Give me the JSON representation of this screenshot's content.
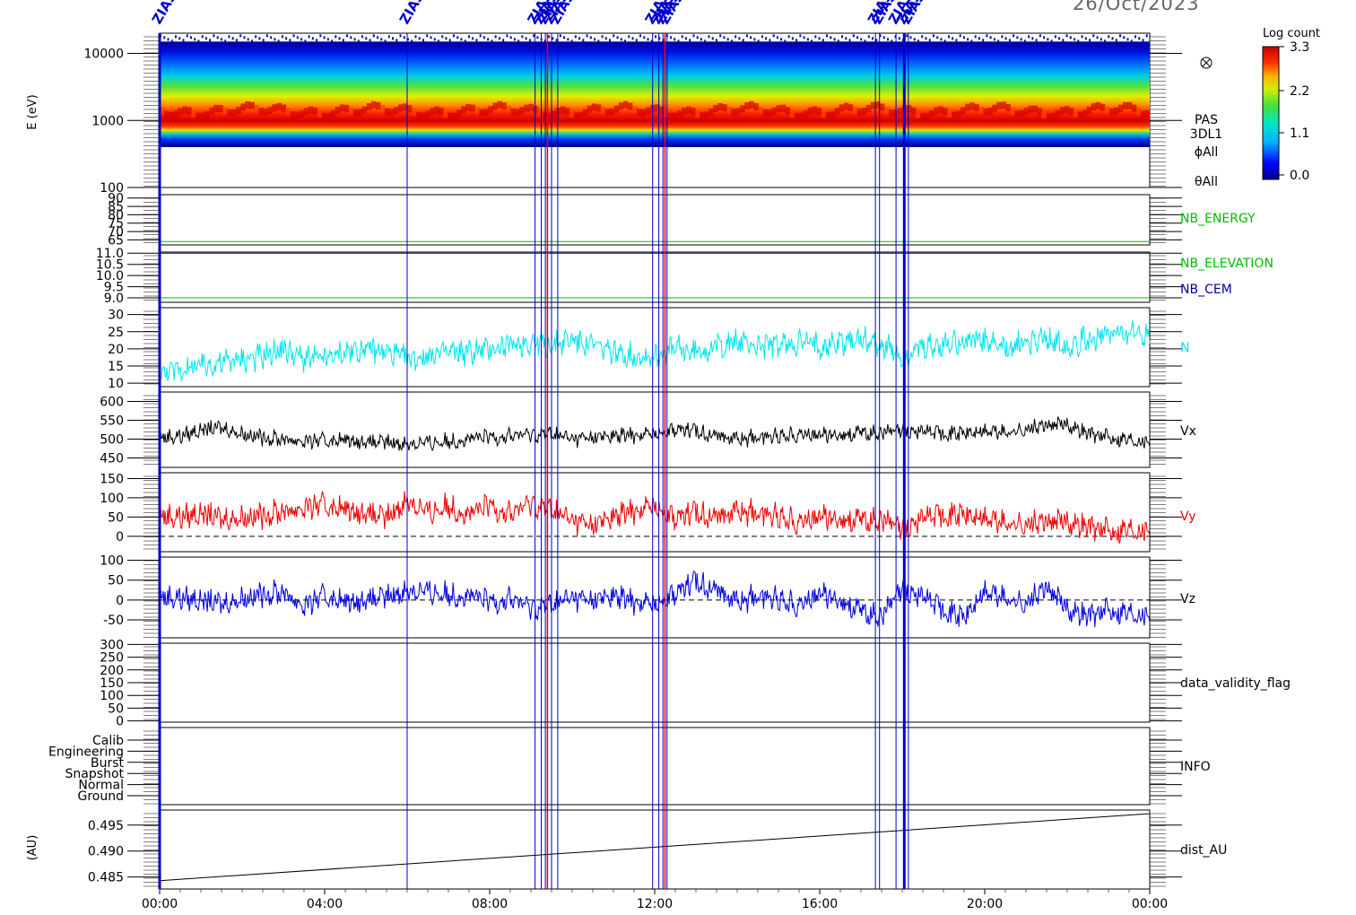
{
  "date_title": "26/Oct/2023",
  "colorbar": {
    "title": "Log count",
    "ticks": [
      "3.3",
      "2.2",
      "1.1",
      "0.0"
    ]
  },
  "x_ticks": [
    "00:00",
    "04:00",
    "08:00",
    "12:00",
    "16:00",
    "20:00",
    "00:00"
  ],
  "event_label": "ZIAS",
  "panel_labels": {
    "spectrogram": [
      "PAS",
      "3DL1",
      "ϕAll",
      "θAll"
    ],
    "nb_energy": "NB_ENERGY",
    "nb_elevation": "NB_ELEVATION",
    "nb_cem": "NB_CEM",
    "density": "N",
    "vx": "Vx",
    "vy": "Vy",
    "vz": "Vz",
    "validity": "data_validity_flag",
    "info": "INFO",
    "dist": "dist_AU"
  },
  "y_axis_labels": {
    "spectrogram": "E (eV)",
    "dist": "(AU)"
  },
  "colors": {
    "density": "#00e5ee",
    "vx": "#000000",
    "vy": "#ee0000",
    "vz": "#0000dd",
    "nb_energy_label": "#00bb00",
    "nb_elevation_label": "#00bb00",
    "nb_cem_label": "#0000aa",
    "event_lines": "#0000cc",
    "event_line_red": "#ee0000"
  },
  "chart_data": [
    {
      "type": "heatmap",
      "name_shown": "PAS 3DL1",
      "ylabel": "E (eV)",
      "y_scale": "log",
      "ylim": [
        100,
        20000
      ],
      "y_ticks": [
        "10000",
        "1000",
        "100"
      ],
      "x_range_hours": [
        0,
        24
      ],
      "colorbar_range": [
        0.0,
        3.3
      ],
      "peak_energy_eV": 1300,
      "data_energy_range_eV": [
        400,
        15000
      ]
    },
    {
      "type": "line",
      "label": "NB_ENERGY",
      "y_ticks": [
        "90",
        "85",
        "80",
        "75",
        "70",
        "65"
      ],
      "ylim": [
        62,
        92
      ],
      "value": 64
    },
    {
      "type": "line",
      "labels": [
        "NB_ELEVATION",
        "NB_CEM"
      ],
      "y_ticks": [
        "11.0",
        "10.5",
        "10.0",
        "9.5",
        "9.0"
      ],
      "ylim": [
        8.8,
        11.05
      ],
      "nb_cem_value": 11.0,
      "nb_elevation_value": 9.0
    },
    {
      "type": "line",
      "label": "N",
      "y_ticks": [
        "30",
        "25",
        "20",
        "15",
        "10"
      ],
      "ylim": [
        9,
        32
      ],
      "x": [
        0,
        0.5,
        1,
        1.5,
        2,
        2.5,
        3,
        3.5,
        4,
        4.5,
        5,
        5.5,
        6,
        6.5,
        7,
        7.5,
        8,
        8.5,
        9,
        9.5,
        10,
        10.5,
        11,
        11.5,
        12,
        12.5,
        13,
        13.5,
        14,
        14.5,
        15,
        15.5,
        16,
        16.5,
        17,
        17.5,
        18,
        18.5,
        19,
        19.5,
        20,
        20.5,
        21,
        21.5,
        22,
        22.5,
        23,
        23.5,
        24
      ],
      "values": [
        13,
        14,
        15,
        16,
        17,
        18,
        20,
        17,
        17,
        19,
        20,
        19,
        17,
        18,
        19,
        19,
        20,
        21,
        22,
        21,
        23,
        21,
        19,
        18,
        18,
        20,
        19,
        21,
        22,
        21,
        21,
        22,
        21,
        22,
        23,
        21,
        18,
        20,
        21,
        23,
        22,
        20,
        22,
        23,
        21,
        23,
        24,
        25,
        24
      ]
    },
    {
      "type": "line",
      "label": "Vx",
      "y_ticks": [
        "600",
        "550",
        "500",
        "450"
      ],
      "ylim": [
        425,
        625
      ],
      "x": [
        0,
        0.5,
        1,
        1.5,
        2,
        2.5,
        3,
        3.5,
        4,
        4.5,
        5,
        5.5,
        6,
        6.5,
        7,
        7.5,
        8,
        8.5,
        9,
        9.5,
        10,
        10.5,
        11,
        11.5,
        12,
        12.5,
        13,
        13.5,
        14,
        14.5,
        15,
        15.5,
        16,
        16.5,
        17,
        17.5,
        18,
        18.5,
        19,
        19.5,
        20,
        20.5,
        21,
        21.5,
        22,
        22.5,
        23,
        23.5,
        24
      ],
      "values": [
        505,
        508,
        525,
        530,
        515,
        505,
        500,
        495,
        495,
        498,
        492,
        490,
        488,
        490,
        495,
        500,
        505,
        510,
        512,
        515,
        500,
        505,
        508,
        510,
        515,
        528,
        520,
        512,
        500,
        505,
        510,
        515,
        510,
        512,
        515,
        518,
        520,
        522,
        518,
        515,
        520,
        518,
        525,
        535,
        540,
        515,
        505,
        500,
        495
      ]
    },
    {
      "type": "line",
      "label": "Vy",
      "y_ticks": [
        "150",
        "100",
        "50",
        "0"
      ],
      "ylim": [
        -40,
        165
      ],
      "zero_line": true,
      "x": [
        0,
        0.5,
        1,
        1.5,
        2,
        2.5,
        3,
        3.5,
        4,
        4.5,
        5,
        5.5,
        6,
        6.5,
        7,
        7.5,
        8,
        8.5,
        9,
        9.5,
        10,
        10.5,
        11,
        11.5,
        12,
        12.5,
        13,
        13.5,
        14,
        14.5,
        15,
        15.5,
        16,
        16.5,
        17,
        17.5,
        18,
        18.5,
        19,
        19.5,
        20,
        20.5,
        21,
        21.5,
        22,
        22.5,
        23,
        23.5,
        24
      ],
      "values": [
        55,
        50,
        60,
        45,
        50,
        55,
        65,
        75,
        80,
        70,
        60,
        45,
        95,
        60,
        80,
        55,
        80,
        60,
        85,
        70,
        40,
        30,
        50,
        65,
        80,
        50,
        60,
        55,
        65,
        60,
        55,
        40,
        50,
        45,
        40,
        45,
        15,
        50,
        60,
        55,
        45,
        35,
        30,
        35,
        40,
        25,
        15,
        20,
        20
      ]
    },
    {
      "type": "line",
      "label": "Vz",
      "y_ticks": [
        "100",
        "50",
        "0",
        "-50"
      ],
      "ylim": [
        -95,
        108
      ],
      "zero_line": true,
      "x": [
        0,
        0.5,
        1,
        1.5,
        2,
        2.5,
        3,
        3.5,
        4,
        4.5,
        5,
        5.5,
        6,
        6.5,
        7,
        7.5,
        8,
        8.5,
        9,
        9.5,
        10,
        10.5,
        11,
        11.5,
        12,
        12.5,
        13,
        13.5,
        14,
        14.5,
        15,
        15.5,
        16,
        16.5,
        17,
        17.5,
        18,
        18.5,
        19,
        19.5,
        20,
        20.5,
        21,
        21.5,
        22,
        22.5,
        23,
        23.5,
        24
      ],
      "values": [
        10,
        5,
        0,
        -10,
        5,
        15,
        20,
        -15,
        10,
        -5,
        0,
        5,
        25,
        20,
        15,
        10,
        -5,
        5,
        -20,
        -10,
        5,
        0,
        10,
        -5,
        -10,
        20,
        45,
        30,
        -5,
        10,
        5,
        -10,
        15,
        0,
        -30,
        -40,
        25,
        10,
        -20,
        -45,
        20,
        5,
        -10,
        30,
        -20,
        -40,
        -25,
        -30,
        -35
      ]
    },
    {
      "type": "line",
      "label": "data_validity_flag",
      "y_ticks": [
        "300",
        "250",
        "200",
        "150",
        "100",
        "50",
        "0"
      ],
      "ylim": [
        -5,
        305
      ]
    },
    {
      "type": "line",
      "label": "INFO",
      "y_ticks": [
        "Calib",
        "Engineering",
        "Burst",
        "Snapshot",
        "Normal",
        "Ground"
      ]
    },
    {
      "type": "line",
      "label": "dist_AU",
      "ylabel": "(AU)",
      "y_ticks": [
        "0.495",
        "0.490",
        "0.485"
      ],
      "ylim": [
        0.4827,
        0.4979
      ],
      "x": [
        0,
        24
      ],
      "values": [
        0.4843,
        0.4972
      ]
    }
  ],
  "event_hours": [
    0.0,
    6.0,
    9.1,
    9.25,
    9.35,
    9.5,
    9.65,
    11.95,
    12.1,
    12.2,
    12.3,
    17.35,
    17.45,
    17.85,
    18.05,
    18.15
  ],
  "event_red_hours": [
    9.4,
    12.25
  ]
}
